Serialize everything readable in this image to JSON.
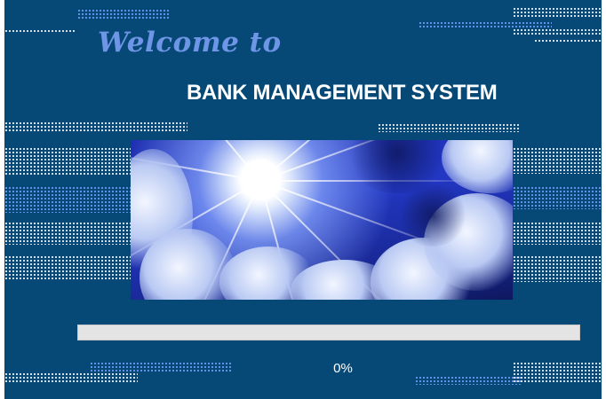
{
  "splash": {
    "welcome_text": "Welcome to",
    "title": "BANK MANAGEMENT SYSTEM",
    "progress_text": "0%",
    "progress_fraction": 0.0
  },
  "colors": {
    "background": "#064977",
    "welcome": "#6f95e6",
    "title": "#ffffff",
    "progress_track": "#e4e4e4"
  }
}
